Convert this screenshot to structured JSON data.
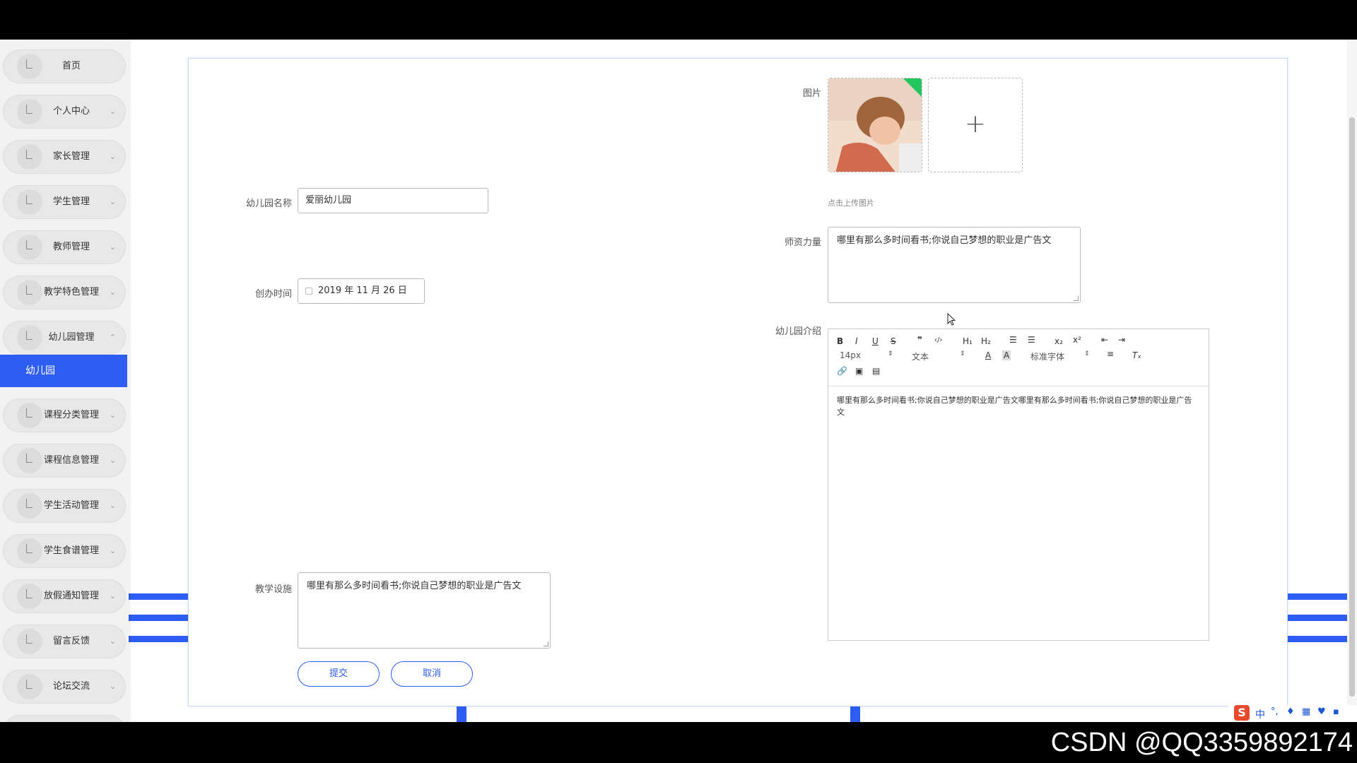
{
  "sidebar": {
    "items": [
      {
        "label": "首页",
        "chevron": ""
      },
      {
        "label": "个人中心",
        "chevron": "⌄"
      },
      {
        "label": "家长管理",
        "chevron": "⌄"
      },
      {
        "label": "学生管理",
        "chevron": "⌄"
      },
      {
        "label": "教师管理",
        "chevron": "⌄"
      },
      {
        "label": "教学特色管理",
        "chevron": "⌄"
      },
      {
        "label": "幼儿园管理",
        "chevron": "⌃"
      },
      {
        "label": "课程分类管理",
        "chevron": "⌄"
      },
      {
        "label": "课程信息管理",
        "chevron": "⌄"
      },
      {
        "label": "学生活动管理",
        "chevron": "⌄"
      },
      {
        "label": "学生食谱管理",
        "chevron": "⌄"
      },
      {
        "label": "放假通知管理",
        "chevron": "⌄"
      },
      {
        "label": "留言反馈",
        "chevron": "⌄"
      },
      {
        "label": "论坛交流",
        "chevron": "⌄"
      }
    ],
    "active_sub_label": "幼儿园"
  },
  "form": {
    "name_label": "幼儿园名称",
    "name_value": "爱丽幼儿园",
    "founded_label": "创办时间",
    "founded_value": "2019 年 11 月 26 日",
    "facilities_label": "教学设施",
    "facilities_value": "哪里有那么多时间看书;你说自己梦想的职业是广告文",
    "image_label": "图片",
    "upload_hint": "点击上传图片",
    "upload_plus": "+",
    "teachers_label": "师资力量",
    "teachers_value": "哪里有那么多时间看书;你说自己梦想的职业是广告文",
    "intro_label": "幼儿园介绍",
    "intro_value": "哪里有那么多时间看书;你说自己梦想的职业是广告文哪里有那么多时间看书;你说自己梦想的职业是广告文",
    "submit_label": "提交",
    "cancel_label": "取消"
  },
  "editor_toolbar": {
    "font_size": "14px",
    "block_type": "文本",
    "font_family": "标准字体"
  },
  "watermark": "CSDN @QQ3359892174",
  "ime": {
    "lang": "中"
  },
  "colors": {
    "accent": "#2e5df3",
    "success_corner": "#22c55e"
  }
}
